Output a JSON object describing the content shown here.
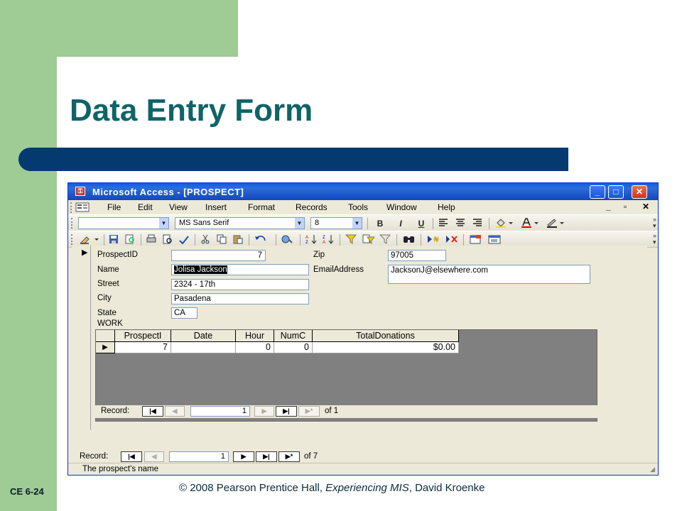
{
  "slide": {
    "title": "Data Entry Form",
    "footer_left": "CE 6-24",
    "footer_copyright": "© 2008 Pearson Prentice Hall, ",
    "footer_book": "Experiencing MIS",
    "footer_author": ", David Kroenke"
  },
  "colors": {
    "accent_green": "#9fcb95",
    "title_teal": "#0f6468",
    "bar_navy": "#053a70",
    "xp_blue": "#0a5fe6"
  },
  "window": {
    "title": "Microsoft Access - [PROSPECT]",
    "controls": {
      "minimize": "_",
      "maximize": "□",
      "close": "✕"
    },
    "mdi_controls": {
      "minimize": "_",
      "restore": "▫",
      "close": "✕"
    }
  },
  "menu": {
    "items": [
      "File",
      "Edit",
      "View",
      "Insert",
      "Format",
      "Records",
      "Tools",
      "Window",
      "Help"
    ]
  },
  "format_toolbar": {
    "object_combo": "",
    "font_combo": "MS Sans Serif",
    "size_combo": "8",
    "bold": "B",
    "italic": "I",
    "underline": "U",
    "icons": [
      "align-left-icon",
      "center-icon",
      "align-right-icon",
      "fill-color-icon",
      "font-color-icon",
      "line-color-icon"
    ]
  },
  "form_toolbar": {
    "icons": [
      "design-view-icon",
      "save-icon",
      "search-icon",
      "print-icon",
      "print-preview-icon",
      "spelling-icon",
      "cut-icon",
      "copy-icon",
      "paste-icon",
      "undo-icon",
      "hyperlink-icon",
      "sort-ascending-icon",
      "sort-descending-icon",
      "filter-by-selection-icon",
      "filter-by-form-icon",
      "apply-filter-icon",
      "find-icon",
      "new-record-icon",
      "delete-record-icon",
      "properties-icon",
      "database-window-icon"
    ]
  },
  "form": {
    "selector": "▶",
    "fields": {
      "prospect_id": {
        "label": "ProspectID",
        "value": "7"
      },
      "name": {
        "label": "Name",
        "value": "Jolisa Jackson"
      },
      "street": {
        "label": "Street",
        "value": "2324 - 17th"
      },
      "city": {
        "label": "City",
        "value": "Pasadena"
      },
      "state": {
        "label": "State",
        "value": "CA"
      },
      "zip": {
        "label": "Zip",
        "value": "97005"
      },
      "email": {
        "label": "EmailAddress",
        "value": "JacksonJ@elsewhere.com"
      }
    },
    "subform_label": "WORK",
    "subform": {
      "columns": [
        "ProspectI",
        "Date",
        "Hour",
        "NumC",
        "TotalDonations"
      ],
      "rows": [
        [
          "7",
          "",
          "0",
          "0",
          "$0.00"
        ]
      ],
      "row_selector": "▶",
      "nav": {
        "label": "Record:",
        "current": "1",
        "of": "of 1"
      }
    },
    "nav": {
      "label": "Record:",
      "current": "1",
      "of": "of 7"
    }
  },
  "status": "The prospect's name"
}
